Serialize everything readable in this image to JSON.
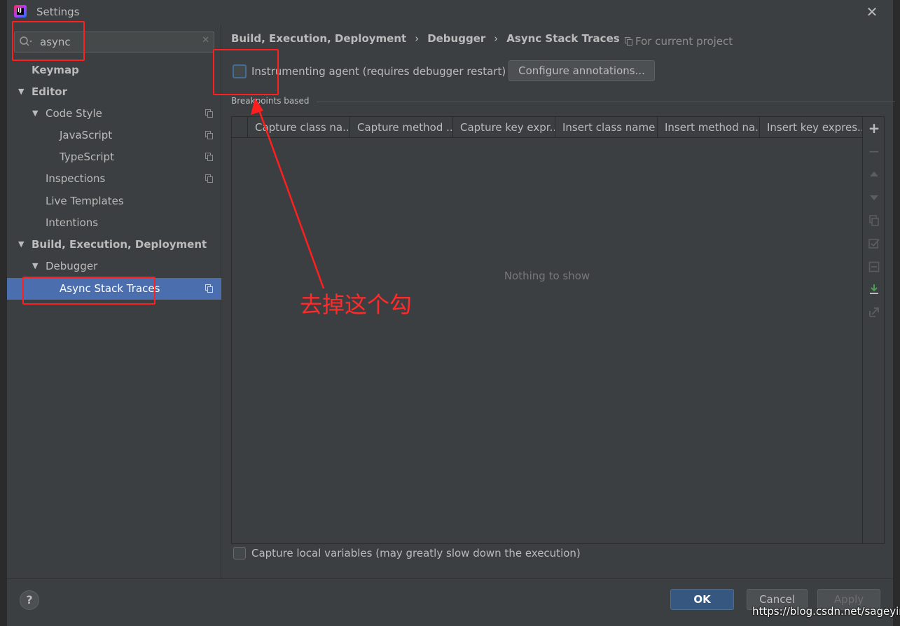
{
  "window": {
    "title": "Settings",
    "close_symbol": "✕"
  },
  "search": {
    "value": "async",
    "clear_symbol": "✕"
  },
  "tree": {
    "keymap": "Keymap",
    "editor": "Editor",
    "code_style": "Code Style",
    "javascript": "JavaScript",
    "typescript": "TypeScript",
    "inspections": "Inspections",
    "live_templates": "Live Templates",
    "intentions": "Intentions",
    "build": "Build, Execution, Deployment",
    "debugger": "Debugger",
    "async_stack_traces": "Async Stack Traces",
    "expanded_arrow": "▼"
  },
  "breadcrumb": {
    "level1": "Build, Execution, Deployment",
    "level2": "Debugger",
    "level3": "Async Stack Traces",
    "separator": "›"
  },
  "scope_label": "For current project",
  "instrumenting": {
    "label": "Instrumenting agent (requires debugger restart)",
    "checked": false
  },
  "configure_button": "Configure annotations...",
  "group_title": "Breakpoints based",
  "table": {
    "columns": [
      "Capture class na...",
      "Capture method ...",
      "Capture key expr...",
      "Insert class name",
      "Insert method na...",
      "Insert key expres..."
    ],
    "empty_text": "Nothing to show"
  },
  "toolbar": {
    "add": "+",
    "remove": "−"
  },
  "capture_local": {
    "label": "Capture local variables (may greatly slow down the execution)",
    "checked": false
  },
  "footer": {
    "help": "?",
    "ok": "OK",
    "cancel": "Cancel",
    "apply": "Apply"
  },
  "annotation": {
    "text": "去掉这个勾",
    "color": "#ff1f1f"
  },
  "watermark": "https://blog.csdn.net/sageyin",
  "colors": {
    "selection": "#4b6eaf",
    "background": "#3c3f41",
    "ok_button": "#365880"
  }
}
